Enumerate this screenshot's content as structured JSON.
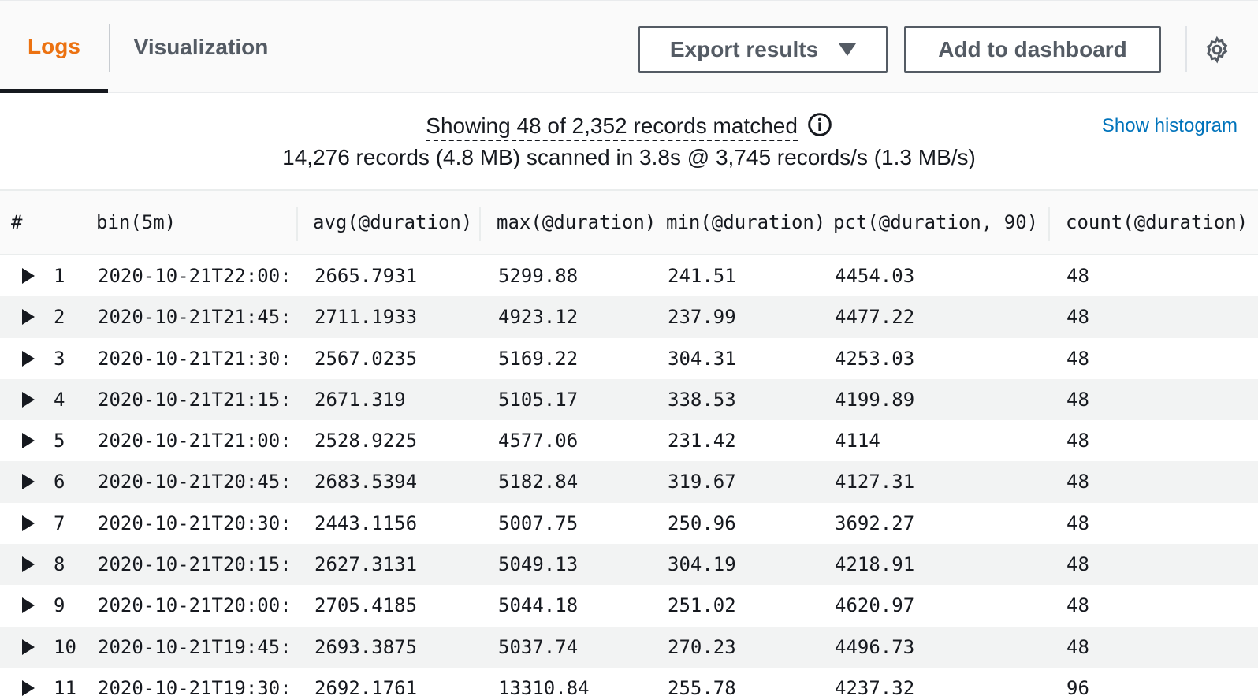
{
  "tabs": {
    "logs": "Logs",
    "visualization": "Visualization"
  },
  "toolbar": {
    "export_label": "Export results",
    "dashboard_label": "Add to dashboard"
  },
  "summary": {
    "matched": "Showing 48 of 2,352 records matched",
    "scanned": "14,276 records (4.8 MB) scanned in 3.8s @ 3,745 records/s (1.3 MB/s)",
    "histogram_link": "Show histogram"
  },
  "table": {
    "headers": [
      "#",
      "bin(5m)",
      "avg(@duration)",
      "max(@duration)",
      "min(@duration)",
      "pct(@duration, 90)",
      "count(@duration)"
    ],
    "rows": [
      [
        "1",
        "2020-10-21T22:00:",
        "2665.7931",
        "5299.88",
        "241.51",
        "4454.03",
        "48"
      ],
      [
        "2",
        "2020-10-21T21:45:",
        "2711.1933",
        "4923.12",
        "237.99",
        "4477.22",
        "48"
      ],
      [
        "3",
        "2020-10-21T21:30:",
        "2567.0235",
        "5169.22",
        "304.31",
        "4253.03",
        "48"
      ],
      [
        "4",
        "2020-10-21T21:15:",
        "2671.319",
        "5105.17",
        "338.53",
        "4199.89",
        "48"
      ],
      [
        "5",
        "2020-10-21T21:00:",
        "2528.9225",
        "4577.06",
        "231.42",
        "4114",
        "48"
      ],
      [
        "6",
        "2020-10-21T20:45:",
        "2683.5394",
        "5182.84",
        "319.67",
        "4127.31",
        "48"
      ],
      [
        "7",
        "2020-10-21T20:30:",
        "2443.1156",
        "5007.75",
        "250.96",
        "3692.27",
        "48"
      ],
      [
        "8",
        "2020-10-21T20:15:",
        "2627.3131",
        "5049.13",
        "304.19",
        "4218.91",
        "48"
      ],
      [
        "9",
        "2020-10-21T20:00:",
        "2705.4185",
        "5044.18",
        "251.02",
        "4620.97",
        "48"
      ],
      [
        "10",
        "2020-10-21T19:45:",
        "2693.3875",
        "5037.74",
        "270.23",
        "4496.73",
        "48"
      ],
      [
        "11",
        "2020-10-21T19:30:",
        "2692.1761",
        "13310.84",
        "255.78",
        "4237.32",
        "96"
      ]
    ]
  },
  "colors": {
    "active_tab": "#ec7211",
    "link": "#0073bb",
    "row_alt": "#f2f3f3"
  },
  "icons": {
    "info": "info-icon",
    "settings": "gear-icon",
    "expand": "caret-right-icon",
    "dropdown": "caret-down-icon"
  }
}
